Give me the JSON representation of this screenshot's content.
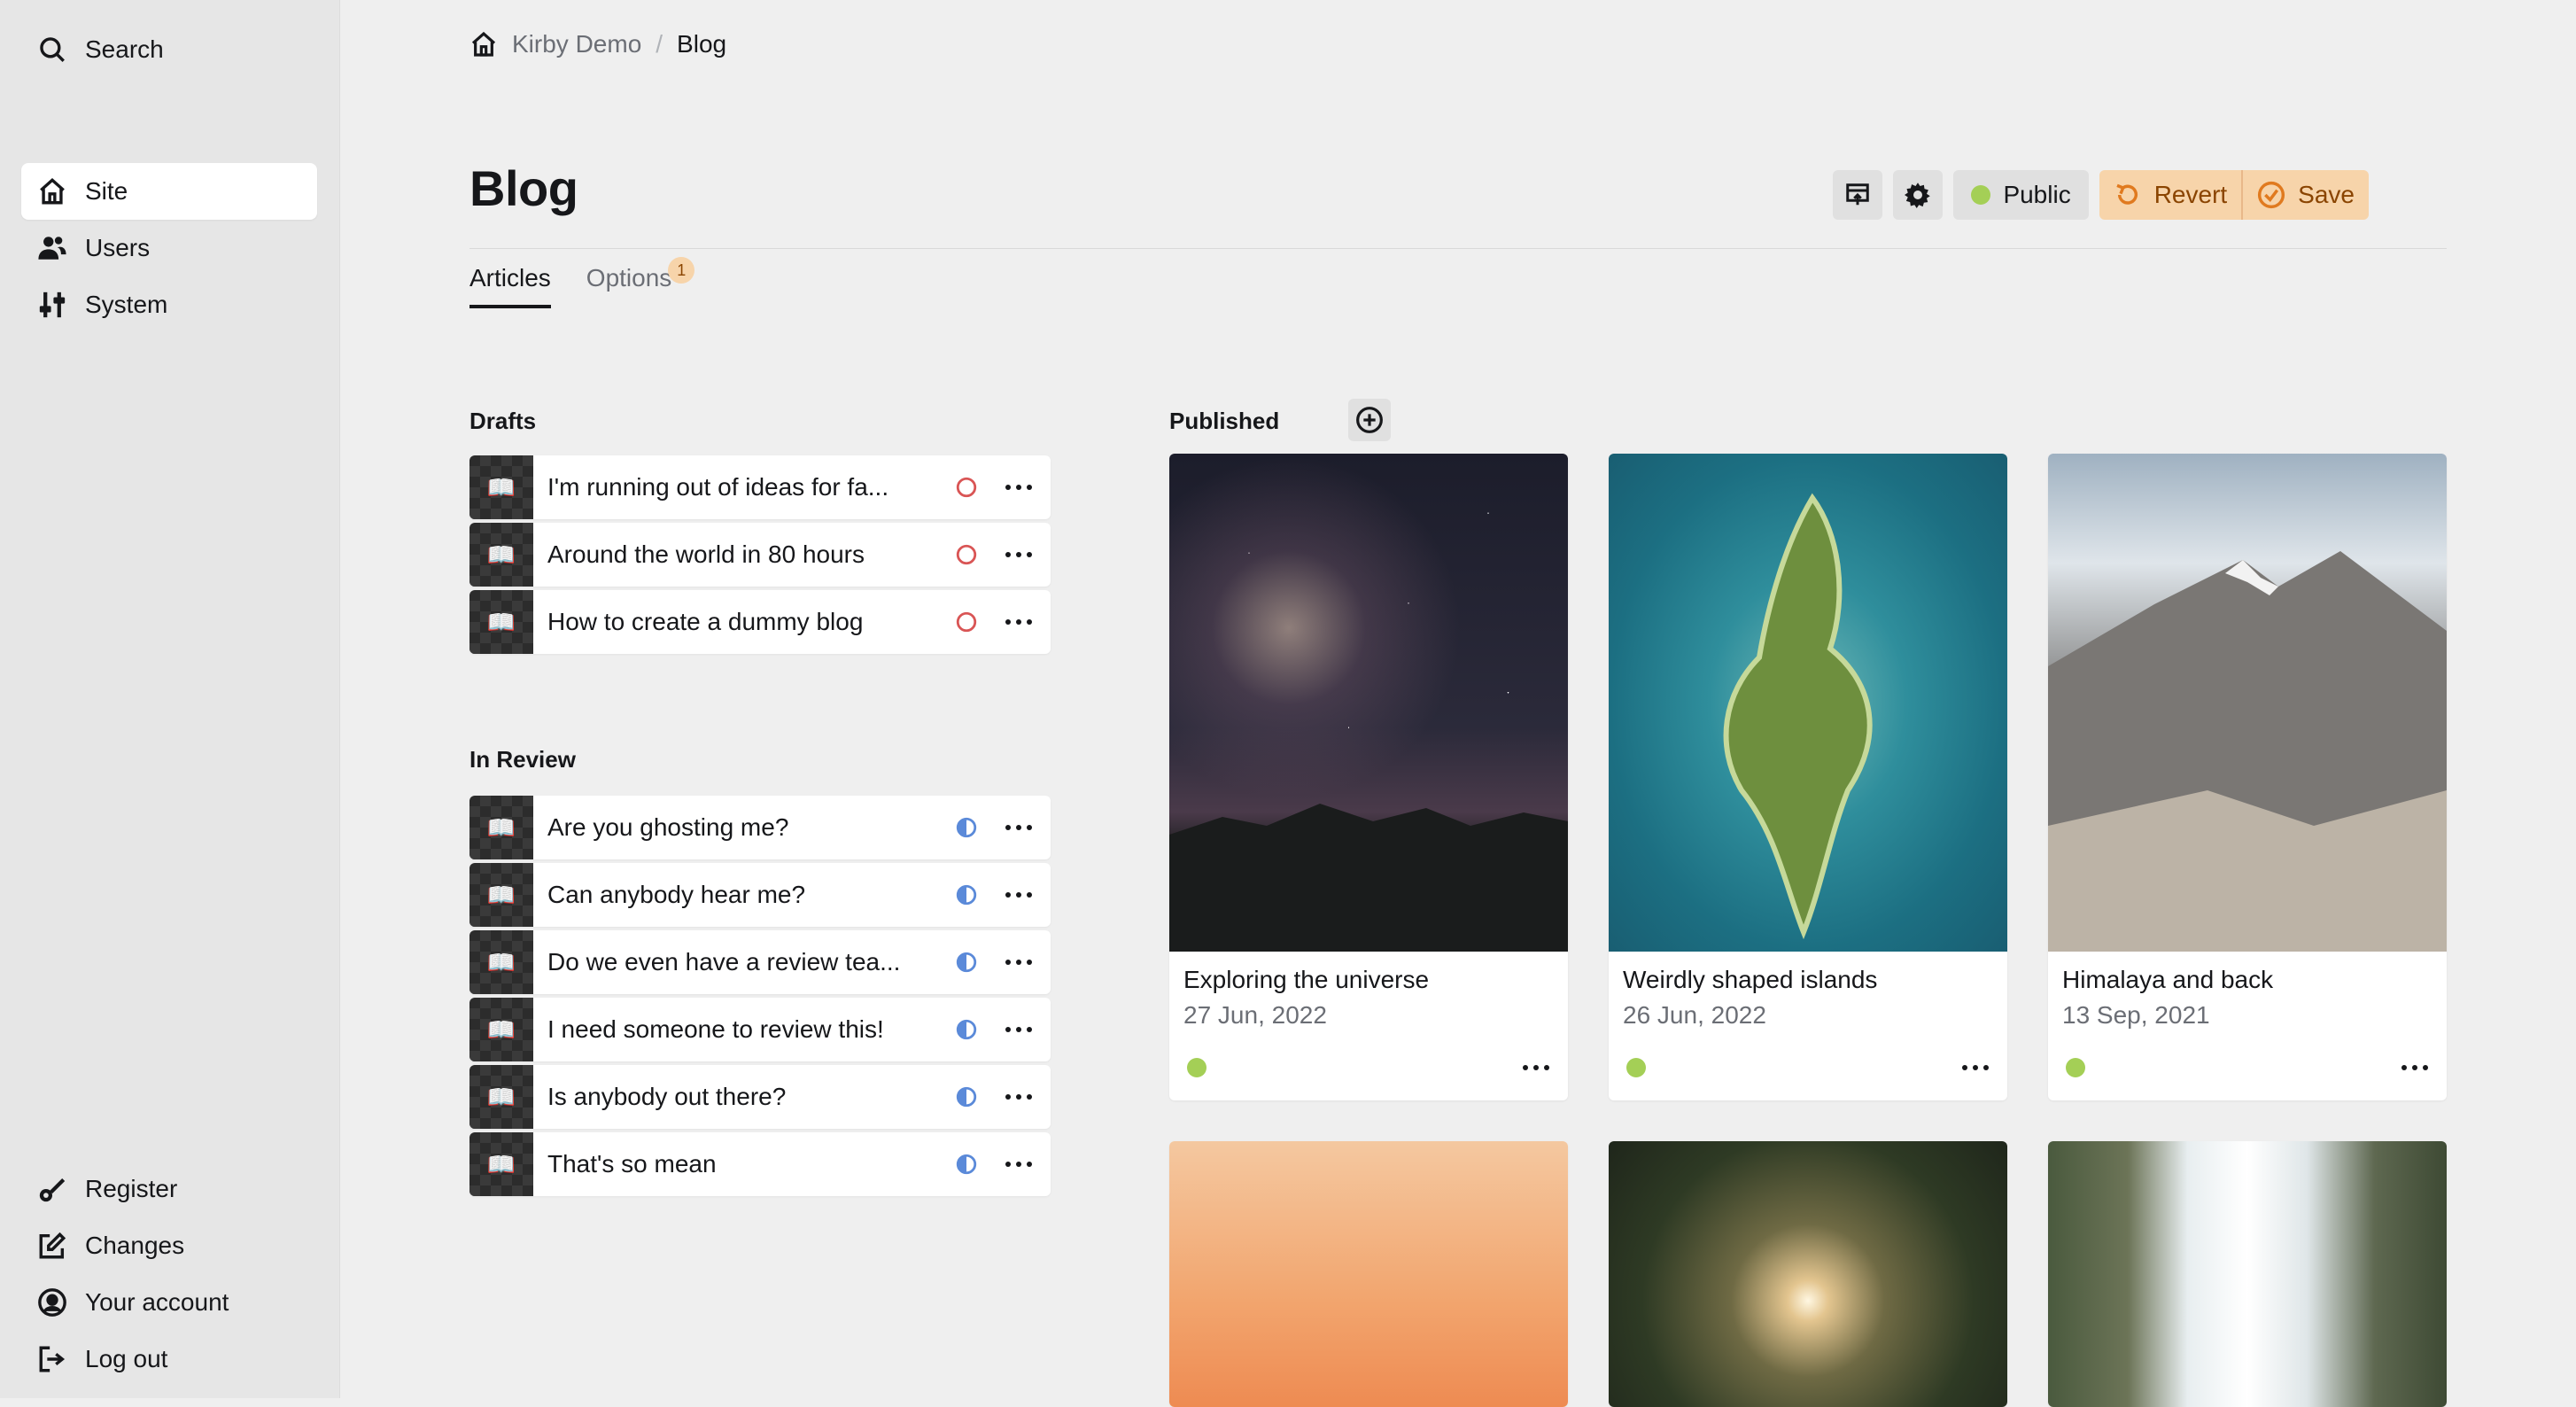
{
  "sidebar": {
    "search_label": "Search",
    "menu": [
      {
        "label": "Site",
        "icon": "home-icon",
        "active": true
      },
      {
        "label": "Users",
        "icon": "users-icon"
      },
      {
        "label": "System",
        "icon": "settings-sliders-icon"
      }
    ],
    "bottom": [
      {
        "label": "Register",
        "icon": "key-icon"
      },
      {
        "label": "Changes",
        "icon": "edit-icon"
      },
      {
        "label": "Your account",
        "icon": "account-icon"
      },
      {
        "label": "Log out",
        "icon": "logout-icon"
      }
    ]
  },
  "breadcrumb": {
    "home": "Kirby Demo",
    "separator": "/",
    "current": "Blog"
  },
  "page": {
    "title": "Blog",
    "status_label": "Public",
    "revert_label": "Revert",
    "save_label": "Save"
  },
  "tabs": [
    {
      "label": "Articles",
      "active": true
    },
    {
      "label": "Options",
      "badge": "1"
    }
  ],
  "drafts": {
    "label": "Drafts",
    "items": [
      {
        "title": "I'm running out of ideas for fa...",
        "status": "draft"
      },
      {
        "title": "Around the world in 80 hours",
        "status": "draft"
      },
      {
        "title": "How to create a dummy blog",
        "status": "draft"
      }
    ]
  },
  "review": {
    "label": "In Review",
    "items": [
      {
        "title": "Are you ghosting me?",
        "status": "unlisted"
      },
      {
        "title": "Can anybody hear me?",
        "status": "unlisted"
      },
      {
        "title": "Do we even have a review tea...",
        "status": "unlisted"
      },
      {
        "title": "I need someone to review this!",
        "status": "unlisted"
      },
      {
        "title": "Is anybody out there?",
        "status": "unlisted"
      },
      {
        "title": "That's so mean",
        "status": "unlisted"
      }
    ]
  },
  "published": {
    "label": "Published",
    "cards": [
      {
        "title": "Exploring the universe",
        "date": "27 Jun, 2022"
      },
      {
        "title": "Weirdly shaped islands",
        "date": "26 Jun, 2022"
      },
      {
        "title": "Himalaya and back",
        "date": "13 Sep, 2021"
      }
    ]
  },
  "colors": {
    "accent_public": "#a4cf56",
    "draft_red": "#d95555",
    "unlisted_blue": "#5b8ad9",
    "changes_bg": "#f7d4aa"
  }
}
